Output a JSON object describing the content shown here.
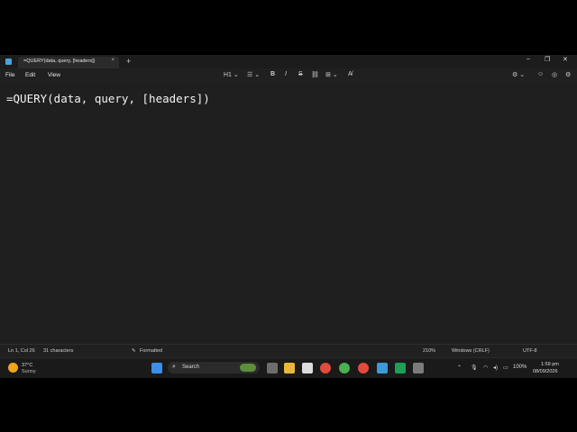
{
  "window": {
    "tab_title": "=QUERY(data, query, [headers])",
    "new_tab": "+",
    "close_tab": "×",
    "controls": {
      "minimize": "–",
      "maximize": "❐",
      "close": "✕"
    }
  },
  "menu": {
    "file": "File",
    "edit": "Edit",
    "view": "View"
  },
  "toolbar": {
    "heading": "H1 ⌄",
    "list": "☰ ⌄",
    "bold": "B",
    "italic": "I",
    "strike": "S",
    "link": "⛓",
    "table": "⊞ ⌄",
    "clear_format": "A̸",
    "right_1": "⚙ ⌄",
    "right_2": "☺",
    "right_3": "◎",
    "right_4": "⚙"
  },
  "editor": {
    "content": "=QUERY(data, query, [headers])"
  },
  "status": {
    "position": "Ln 1, Col 26",
    "characters": "31 characters",
    "formatted": "Formatted",
    "zoom": "210%",
    "line_endings": "Windows (CRLF)",
    "encoding": "UTF-8"
  },
  "taskbar": {
    "weather_temp": "37°C",
    "weather_desc": "Sunny",
    "search_placeholder": "Search",
    "battery": "100%",
    "time": "1:59 pm",
    "date": "08/09/2026",
    "chevron": "⌃"
  }
}
